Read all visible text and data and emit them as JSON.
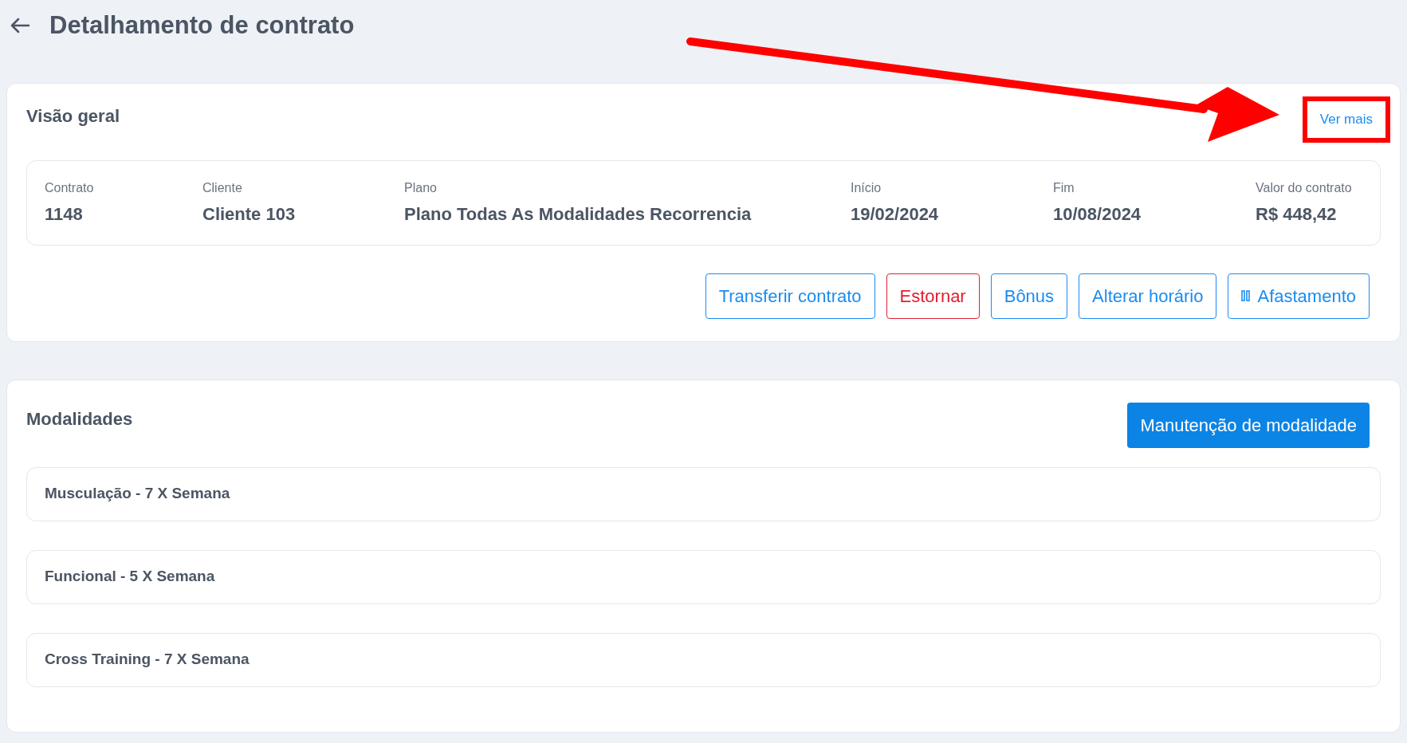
{
  "header": {
    "title": "Detalhamento de contrato"
  },
  "overview": {
    "title": "Visão geral",
    "link": "Ver mais",
    "fields": [
      {
        "label": "Contrato",
        "value": "1148"
      },
      {
        "label": "Cliente",
        "value": "Cliente 103"
      },
      {
        "label": "Plano",
        "value": "Plano Todas As Modalidades Recorrencia"
      },
      {
        "label": "Início",
        "value": "19/02/2024"
      },
      {
        "label": "Fim",
        "value": "10/08/2024"
      },
      {
        "label": "Valor do contrato",
        "value": "R$ 448,42"
      }
    ],
    "actions": [
      {
        "label": "Transferir contrato",
        "kind": "default"
      },
      {
        "label": "Estornar",
        "kind": "danger"
      },
      {
        "label": "Bônus",
        "kind": "default"
      },
      {
        "label": "Alterar horário",
        "kind": "default"
      },
      {
        "label": "Afastamento",
        "kind": "icon"
      }
    ]
  },
  "modalities": {
    "title": "Modalidades",
    "button": "Manutenção de modalidade",
    "items": [
      "Musculação - 7 X Semana",
      "Funcional - 5 X Semana",
      "Cross Training - 7 X Semana"
    ]
  }
}
